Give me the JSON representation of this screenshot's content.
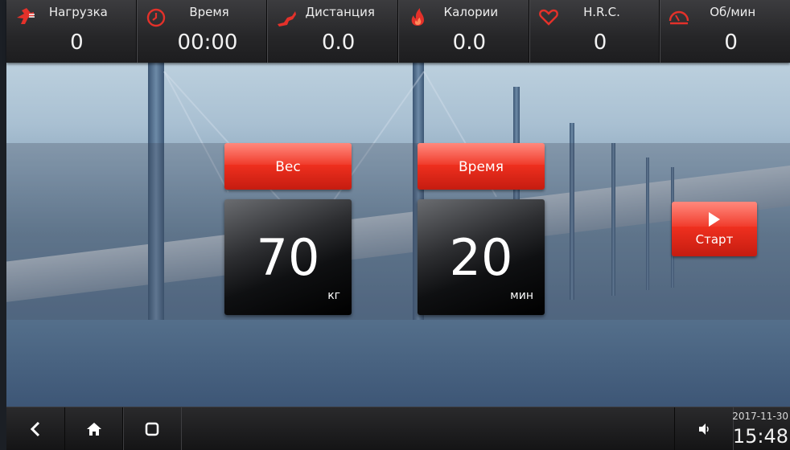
{
  "stats": [
    {
      "icon": "load-icon",
      "label": "Нагрузка",
      "value": "0"
    },
    {
      "icon": "clock-icon",
      "label": "Время",
      "value": "00:00"
    },
    {
      "icon": "runner-icon",
      "label": "Дистанция",
      "value": "0.0"
    },
    {
      "icon": "flame-icon",
      "label": "Калории",
      "value": "0.0"
    },
    {
      "icon": "heart-icon",
      "label": "H.R.C.",
      "value": "0"
    },
    {
      "icon": "speedometer-icon",
      "label": "Об/мин",
      "value": "0"
    }
  ],
  "weight": {
    "header": "Вес",
    "value": "70",
    "unit": "кг"
  },
  "time": {
    "header": "Время",
    "value": "20",
    "unit": "мин"
  },
  "start": {
    "label": "Старт"
  },
  "clock": {
    "date": "2017-11-30",
    "time": "15:48"
  },
  "colors": {
    "accent_red": "#e62d1d",
    "icon_red": "#e4312a"
  }
}
